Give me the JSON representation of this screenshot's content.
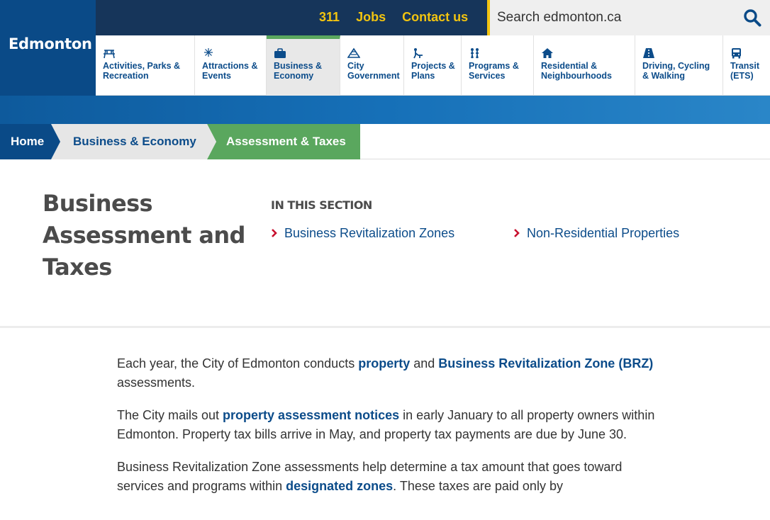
{
  "logo": {
    "text": "Edmonton"
  },
  "top_links": [
    "311",
    "Jobs",
    "Contact us"
  ],
  "search": {
    "placeholder": "Search edmonton.ca"
  },
  "nav": [
    {
      "line1": "Activities, Parks &",
      "line2": "Recreation",
      "icon": "picnic-table-icon"
    },
    {
      "line1": "Attractions &",
      "line2": "Events",
      "icon": "fireworks-icon"
    },
    {
      "line1": "Business &",
      "line2": "Economy",
      "icon": "briefcase-icon",
      "active": true
    },
    {
      "line1": "City",
      "line2": "Government",
      "icon": "pyramid-icon"
    },
    {
      "line1": "Projects &",
      "line2": "Plans",
      "icon": "worker-icon"
    },
    {
      "line1": "Programs &",
      "line2": "Services",
      "icon": "people-icon"
    },
    {
      "line1": "Residential &",
      "line2": "Neighbourhoods",
      "icon": "house-icon"
    },
    {
      "line1": "Driving, Cycling",
      "line2": "& Walking",
      "icon": "road-icon"
    },
    {
      "line1": "Transit",
      "line2": "(ETS)",
      "icon": "bus-icon"
    }
  ],
  "breadcrumb": [
    "Home",
    "Business & Economy",
    "Assessment & Taxes"
  ],
  "page": {
    "title_lines": [
      "Business",
      "Assessment and",
      "Taxes"
    ],
    "section_label": "IN THIS SECTION",
    "section_links": [
      "Business Revitalization Zones",
      "Non-Residential Properties"
    ]
  },
  "content": {
    "p1": {
      "t1": "Each year, the City of Edmonton conducts ",
      "link1": "property",
      "t2": " and ",
      "link2": "Business Revitalization Zone (BRZ)",
      "t3": " assessments."
    },
    "p2": {
      "t1": "The City mails out ",
      "link1": "property assessment notices",
      "t2": " in early January to all property owners within Edmonton. Property tax bills arrive in May, and property tax payments are due by June 30."
    },
    "p3": {
      "t1": "Business Revitalization Zone assessments help determine a tax amount that goes toward services and programs within ",
      "link1": "designated zones",
      "t2": ". These taxes are paid only by"
    }
  },
  "colors": {
    "brand_blue": "#0a4a87",
    "top_bar": "#16355a",
    "accent_yellow": "#f2c410",
    "accent_green": "#5aa75e",
    "link": "#0c4c8a",
    "chevron_red": "#c8102e"
  }
}
